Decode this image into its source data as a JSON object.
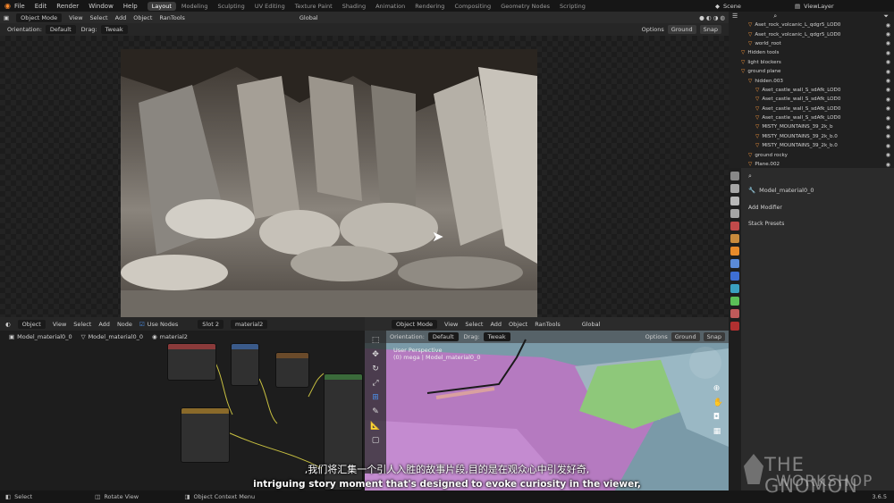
{
  "menu": [
    "File",
    "Edit",
    "Render",
    "Window",
    "Help"
  ],
  "workspaces": [
    "Layout",
    "Modeling",
    "Sculpting",
    "UV Editing",
    "Texture Paint",
    "Shading",
    "Animation",
    "Rendering",
    "Compositing",
    "Geometry Nodes",
    "Scripting"
  ],
  "scene": "Scene",
  "view_layer": "ViewLayer",
  "hdr1": {
    "mode": "Object Mode",
    "items": [
      "View",
      "Select",
      "Add",
      "Object",
      "RanTools"
    ],
    "transform": "Global"
  },
  "hdr2": {
    "orientation_label": "Orientation:",
    "orientation": "Default",
    "drag_label": "Drag:",
    "drag": "Tweak",
    "options": "Options",
    "ground": "Ground",
    "snap": "Snap"
  },
  "outliner": [
    {
      "name": "Aset_rock_volcanic_L_qdgr5_LOD0",
      "indent": 1
    },
    {
      "name": "Aset_rock_volcanic_L_qdgr5_LOD0",
      "indent": 1
    },
    {
      "name": "world_root",
      "indent": 1
    },
    {
      "name": "Hidden tools",
      "indent": 0
    },
    {
      "name": "light blockers",
      "indent": 0
    },
    {
      "name": "ground plane",
      "indent": 0
    },
    {
      "name": "hidden.003",
      "indent": 1
    },
    {
      "name": "Aset_castle_wall_S_sdAfk_LOD0",
      "indent": 2
    },
    {
      "name": "Aset_castle_wall_S_sdAfk_LOD0",
      "indent": 2
    },
    {
      "name": "Aset_castle_wall_S_sdAfk_LOD0",
      "indent": 2
    },
    {
      "name": "Aset_castle_wall_S_sdAfk_LOD0",
      "indent": 2
    },
    {
      "name": "MISTY_MOUNTAINS_39_2k_b",
      "indent": 2
    },
    {
      "name": "MISTY_MOUNTAINS_39_2k_b.0",
      "indent": 2
    },
    {
      "name": "MISTY_MOUNTAINS_39_2k_b.0",
      "indent": 2
    },
    {
      "name": "ground rocky",
      "indent": 1
    },
    {
      "name": "Plane.002",
      "indent": 1
    }
  ],
  "props": {
    "object": "Model_material0_0",
    "add_modifier": "Add Modifier",
    "stack_presets": "Stack Presets"
  },
  "node_hdr": {
    "type": "Object",
    "items": [
      "View",
      "Select",
      "Add",
      "Node"
    ],
    "use_nodes": "Use Nodes",
    "slot": "Slot 2",
    "material": "material2"
  },
  "node_crumb": {
    "obj": "Model_material0_0",
    "mesh": "Model_material0_0",
    "mat": "material2"
  },
  "vp2": {
    "mode": "Object Mode",
    "items": [
      "View",
      "Select",
      "Add",
      "Object",
      "RanTools"
    ],
    "transform": "Global",
    "orientation_label": "Orientation:",
    "orientation": "Default",
    "drag_label": "Drag:",
    "drag": "Tweak",
    "options": "Options",
    "ground": "Ground",
    "snap": "Snap",
    "perspective": "User Perspective",
    "object_info": "(0) mega | Model_material0_0"
  },
  "status": {
    "select": "Select",
    "rotate": "Rotate View",
    "context": "Object Context Menu",
    "version": "3.6.5"
  },
  "subtitles": {
    "zh": ",我们将汇集一个引人入胜的故事片段,目的是在观众心中引发好奇,",
    "en": "intriguing story moment that's designed to evoke curiosity in the viewer,"
  },
  "watermark": {
    "line1": "THE GNOMON",
    "line2": "WORKSHOP"
  }
}
